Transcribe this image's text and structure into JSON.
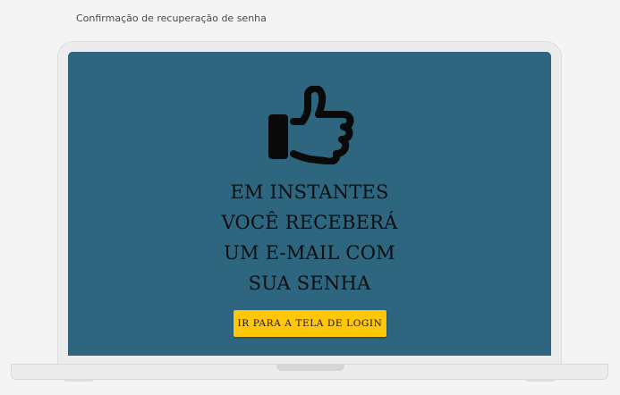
{
  "page": {
    "label": "Confirmação de recuperação de senha"
  },
  "screen": {
    "icon": "thumbs-up-icon",
    "message_lines": [
      "EM INSTANTES",
      "VOCÊ RECEBERÁ",
      "UM E-MAIL COM",
      "SUA SENHA"
    ],
    "button_label": "IR PARA A TELA DE LOGIN"
  },
  "colors": {
    "page_background": "#f4f4f4",
    "screen_background": "#2e6680",
    "button_background": "#ffc60a",
    "text": "#0e0e0e"
  }
}
